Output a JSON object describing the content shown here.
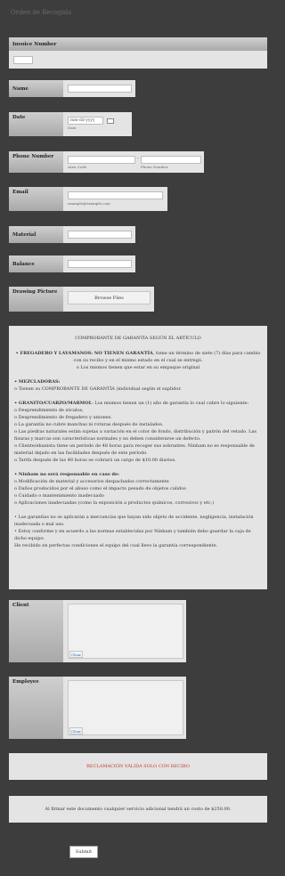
{
  "form": {
    "title": "Orden de Recogida"
  },
  "fields": {
    "invoice": {
      "label": "Invoice Number",
      "value": ""
    },
    "name": {
      "label": "Name",
      "value": ""
    },
    "date": {
      "label": "Date",
      "placeholder": "mm-dd-yyyy",
      "sublabel": "Date",
      "icon": "calendar-icon"
    },
    "phone": {
      "label": "Phone Number",
      "area_code_sublabel": "Area Code",
      "phone_sublabel": "Phone Number",
      "separator": "-"
    },
    "email": {
      "label": "Email",
      "sublabel": "example@example.com"
    },
    "material": {
      "label": "Material"
    },
    "balance": {
      "label": "Balance"
    },
    "drawing": {
      "label": "Drawing Picture",
      "button": "Browse Files"
    }
  },
  "terms": {
    "title": "COMPROBANTE DE GARANTÍA SEGÚN EL ARTÍCULO",
    "p1_bold": "• FREGADERO Y LAVAMANOS: NO TIENEN GARANTÍA",
    "p1_rest": ", tiene un término de siete (7) días para cambio con su recibo y en el mismo estado en el cual se entregó.",
    "p1_line2": "o Los mismos tienen que estar en su empaque original",
    "mezcla_bold": "• MEZCLADORAS:",
    "mezcla_line": "o Tienen su COMPROBANTE DE GARANTÍA (individual según el suplidor.",
    "granito_bold": "• GRANITO/CUARZO/MARMOL",
    "granito_rest": ": Los mismos tienen un (1) año de garantía lo cual cubre lo siguiente:",
    "granito_items": [
      "o Desprendimiento de zócalos,",
      "o Desprendimiento de fregadero y uniones.",
      "o La garantía no cubre manchas ni roturas después de instalados.",
      "o Las piedras naturales están sujetas a variación en el color de fondo, distribución y patrón del vetado. Las fisuras y marcas son características normales y no deben considerarse un defecto.",
      "o Cliente/ebanista tiene un periodo de 48 horas para recoger sus sobrantes. Ninham no es responsable de material dejado en las facilidades después de este período.",
      "o Tarifa después de las 48 horas se cobrará un cargo de $10.00 diarios."
    ],
    "ninham_bold": "• Ninham no será responsable en caso de:",
    "ninham_items": [
      "o Modificación de material y accesorios despachados correctamente",
      "o Daños producidos por el abuso como el impacto pesado de objetos calidos",
      "o Cuidado o mantenimiento inadecuado",
      "o Aplicaciones inadecuadas (como la exposición a productos químicos, corrosivos y etc.)"
    ],
    "closing": [
      "• Las garantías no se aplicarán a mercancías que hayan sido objeto de accidente, negligencia, instalación inadecuada o mal uso.",
      "• Estoy conforme y en acuerdo a las normas establecidas por Ninham y también debo guardar la caja de dicho equipo.",
      "He recibido en perfectas condiciones el equipo del cual llevo la garantía correspondiente."
    ]
  },
  "signatures": {
    "client": {
      "label": "Client",
      "clear": "Clear"
    },
    "employee": {
      "label": "Employee",
      "clear": "Clear"
    }
  },
  "notice": "RECLAMACIÓN VÁLIDA SOLO CON RECIBO",
  "fee_notice": "Al firmar este documento cualquier servicio adicional tendrá un costo de $250.00.",
  "submit": "Submit",
  "colors": {
    "background": "#3d3d3d",
    "panel": "#e4e4e4",
    "notice_red": "#c0392b"
  }
}
